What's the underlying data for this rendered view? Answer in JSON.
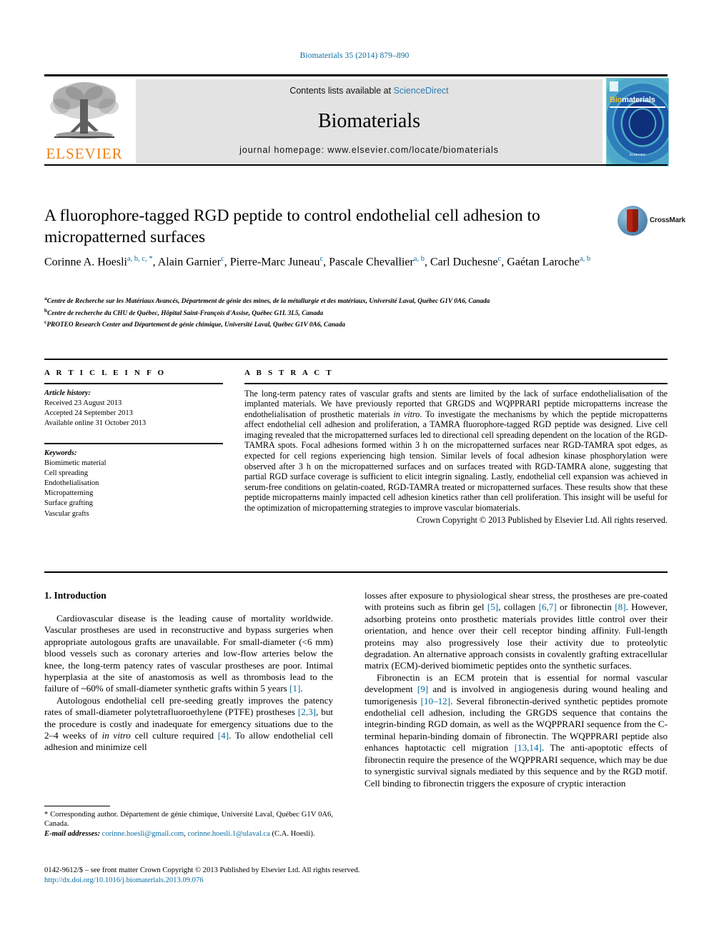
{
  "running_head": "Biomaterials 35 (2014) 879–890",
  "masthead": {
    "contents_prefix": "Contents lists available at",
    "sciencedirect": "ScienceDirect",
    "journal_name": "Biomaterials",
    "homepage": "journal homepage: www.elsevier.com/locate/biomaterials",
    "publisher_logo_text": "ELSEVIER",
    "cover": {
      "title_first": "Bio",
      "title_rest": "materials",
      "footer": "ELSEVIER"
    }
  },
  "article": {
    "title": "A fluorophore-tagged RGD peptide to control endothelial cell adhesion to micropatterned surfaces",
    "crossmark_label": "CrossMark",
    "authors_line1_pre": "Corinne A. Hoesli",
    "authors": [
      {
        "name": "Corinne A. Hoesli",
        "sup": "a, b, c, *"
      },
      {
        "name": "Alain Garnier",
        "sup": "c"
      },
      {
        "name": "Pierre-Marc Juneau",
        "sup": "c"
      },
      {
        "name": "Pascale Chevallier",
        "sup": "a, b"
      },
      {
        "name": "Carl Duchesne",
        "sup": "c"
      },
      {
        "name": "Gaétan Laroche",
        "sup": "a, b"
      }
    ],
    "affiliations": [
      {
        "marker": "a",
        "text": "Centre de Recherche sur les Matériaux Avancés, Département de génie des mines, de la métallurgie et des matériaux, Université Laval, Québec G1V 0A6, Canada"
      },
      {
        "marker": "b",
        "text": "Centre de recherche du CHU de Québec, Hôpital Saint-François d'Assise, Québec G1L 3L5, Canada"
      },
      {
        "marker": "c",
        "text": "PROTEO Research Center and Département de génie chimique, Université Laval, Québec G1V 0A6, Canada"
      }
    ]
  },
  "article_info": {
    "heading": "A R T I C L E    I N F O",
    "history_label": "Article history:",
    "history": [
      "Received 23 August 2013",
      "Accepted 24 September 2013",
      "Available online 31 October 2013"
    ],
    "keywords_label": "Keywords:",
    "keywords": [
      "Biomimetic material",
      "Cell spreading",
      "Endothelialisation",
      "Micropatterning",
      "Surface grafting",
      "Vascular grafts"
    ]
  },
  "abstract": {
    "heading": "A B S T R A C T",
    "part1": "The long-term patency rates of vascular grafts and stents are limited by the lack of surface endothelialisation of the implanted materials. We have previously reported that GRGDS and WQPPRARI peptide micropatterns increase the endothelialisation of prosthetic materials ",
    "italic1": "in vitro",
    "part2": ". To investigate the mechanisms by which the peptide micropatterns affect endothelial cell adhesion and proliferation, a TAMRA fluorophore-tagged RGD peptide was designed. Live cell imaging revealed that the micropatterned surfaces led to directional cell spreading dependent on the location of the RGD-TAMRA spots. Focal adhesions formed within 3 h on the micropatterned surfaces near RGD-TAMRA spot edges, as expected for cell regions experiencing high tension. Similar levels of focal adhesion kinase phosphorylation were observed after 3 h on the micropatterned surfaces and on surfaces treated with RGD-TAMRA alone, suggesting that partial RGD surface coverage is sufficient to elicit integrin signaling. Lastly, endothelial cell expansion was achieved in serum-free conditions on gelatin-coated, RGD-TAMRA treated or micropatterned surfaces. These results show that these peptide micropatterns mainly impacted cell adhesion kinetics rather than cell proliferation. This insight will be useful for the optimization of micropatterning strategies to improve vascular biomaterials.",
    "copyright": "Crown Copyright © 2013 Published by Elsevier Ltd. All rights reserved."
  },
  "body": {
    "section_heading": "1. Introduction",
    "left_paragraphs": [
      {
        "segments": [
          {
            "t": "Cardiovascular disease is the leading cause of mortality worldwide. Vascular prostheses are used in reconstructive and bypass surgeries when appropriate autologous grafts are unavailable. For small-diameter (<6 mm) blood vessels such as coronary arteries and low-flow arteries below the knee, the long-term patency rates of vascular prostheses are poor. Intimal hyperplasia at the site of anastomosis as well as thrombosis lead to the failure of ~60% of small-diameter synthetic grafts within 5 years ",
            "style": "normal"
          },
          {
            "t": "[1]",
            "style": "ref"
          },
          {
            "t": ".",
            "style": "normal"
          }
        ]
      },
      {
        "segments": [
          {
            "t": "Autologous endothelial cell pre-seeding greatly improves the patency rates of small-diameter polytetrafluoroethylene (PTFE) prostheses ",
            "style": "normal"
          },
          {
            "t": "[2,3]",
            "style": "ref"
          },
          {
            "t": ", but the procedure is costly and inadequate for emergency situations due to the 2–4 weeks of ",
            "style": "normal"
          },
          {
            "t": "in vitro",
            "style": "italic"
          },
          {
            "t": " cell culture required ",
            "style": "normal"
          },
          {
            "t": "[4]",
            "style": "ref"
          },
          {
            "t": ". To allow endothelial cell adhesion and minimize cell",
            "style": "normal"
          }
        ]
      }
    ],
    "right_paragraphs": [
      {
        "continued": true,
        "segments": [
          {
            "t": "losses after exposure to physiological shear stress, the prostheses are pre-coated with proteins such as fibrin gel ",
            "style": "normal"
          },
          {
            "t": "[5]",
            "style": "ref"
          },
          {
            "t": ", collagen ",
            "style": "normal"
          },
          {
            "t": "[6,7]",
            "style": "ref"
          },
          {
            "t": " or fibronectin ",
            "style": "normal"
          },
          {
            "t": "[8]",
            "style": "ref"
          },
          {
            "t": ". However, adsorbing proteins onto prosthetic materials provides little control over their orientation, and hence over their cell receptor binding affinity. Full-length proteins may also progressively lose their activity due to proteolytic degradation. An alternative approach consists in covalently grafting extracellular matrix (ECM)-derived biomimetic peptides onto the synthetic surfaces.",
            "style": "normal"
          }
        ]
      },
      {
        "continued": false,
        "segments": [
          {
            "t": "Fibronectin is an ECM protein that is essential for normal vascular development ",
            "style": "normal"
          },
          {
            "t": "[9]",
            "style": "ref"
          },
          {
            "t": " and is involved in angiogenesis during wound healing and tumorigenesis ",
            "style": "normal"
          },
          {
            "t": "[10–12]",
            "style": "ref"
          },
          {
            "t": ". Several fibronectin-derived synthetic peptides promote endothelial cell adhesion, including the GRGDS sequence that contains the integrin-binding RGD domain, as well as the WQPPRARI sequence from the C-terminal heparin-binding domain of fibronectin. The WQPPRARI peptide also enhances haptotactic cell migration ",
            "style": "normal"
          },
          {
            "t": "[13,14]",
            "style": "ref"
          },
          {
            "t": ". The anti-apoptotic effects of fibronectin require the presence of the WQPPRARI sequence, which may be due to synergistic survival signals mediated by this sequence and by the RGD motif. Cell binding to fibronectin triggers the exposure of cryptic interaction",
            "style": "normal"
          }
        ]
      }
    ]
  },
  "footnote": {
    "corresponding": "* Corresponding author. Département de génie chimique, Université Laval, Québec G1V 0A6, Canada.",
    "email_label": "E-mail addresses:",
    "email1": "corinne.hoesli@gmail.com",
    "email_sep": ",",
    "email2": "corinne.hoesli.1@ulaval.ca",
    "email_attrib": "(C.A. Hoesli)."
  },
  "colophon": {
    "line1": "0142-9612/$ – see front matter Crown Copyright © 2013 Published by Elsevier Ltd. All rights reserved.",
    "doi": "http://dx.doi.org/10.1016/j.biomaterials.2013.09.076"
  },
  "colors": {
    "link": "#0b6ba0",
    "sciencedirect": "#2e7db2",
    "elsevier_orange": "#ec8315",
    "band_gray": "#e3e3e3"
  }
}
